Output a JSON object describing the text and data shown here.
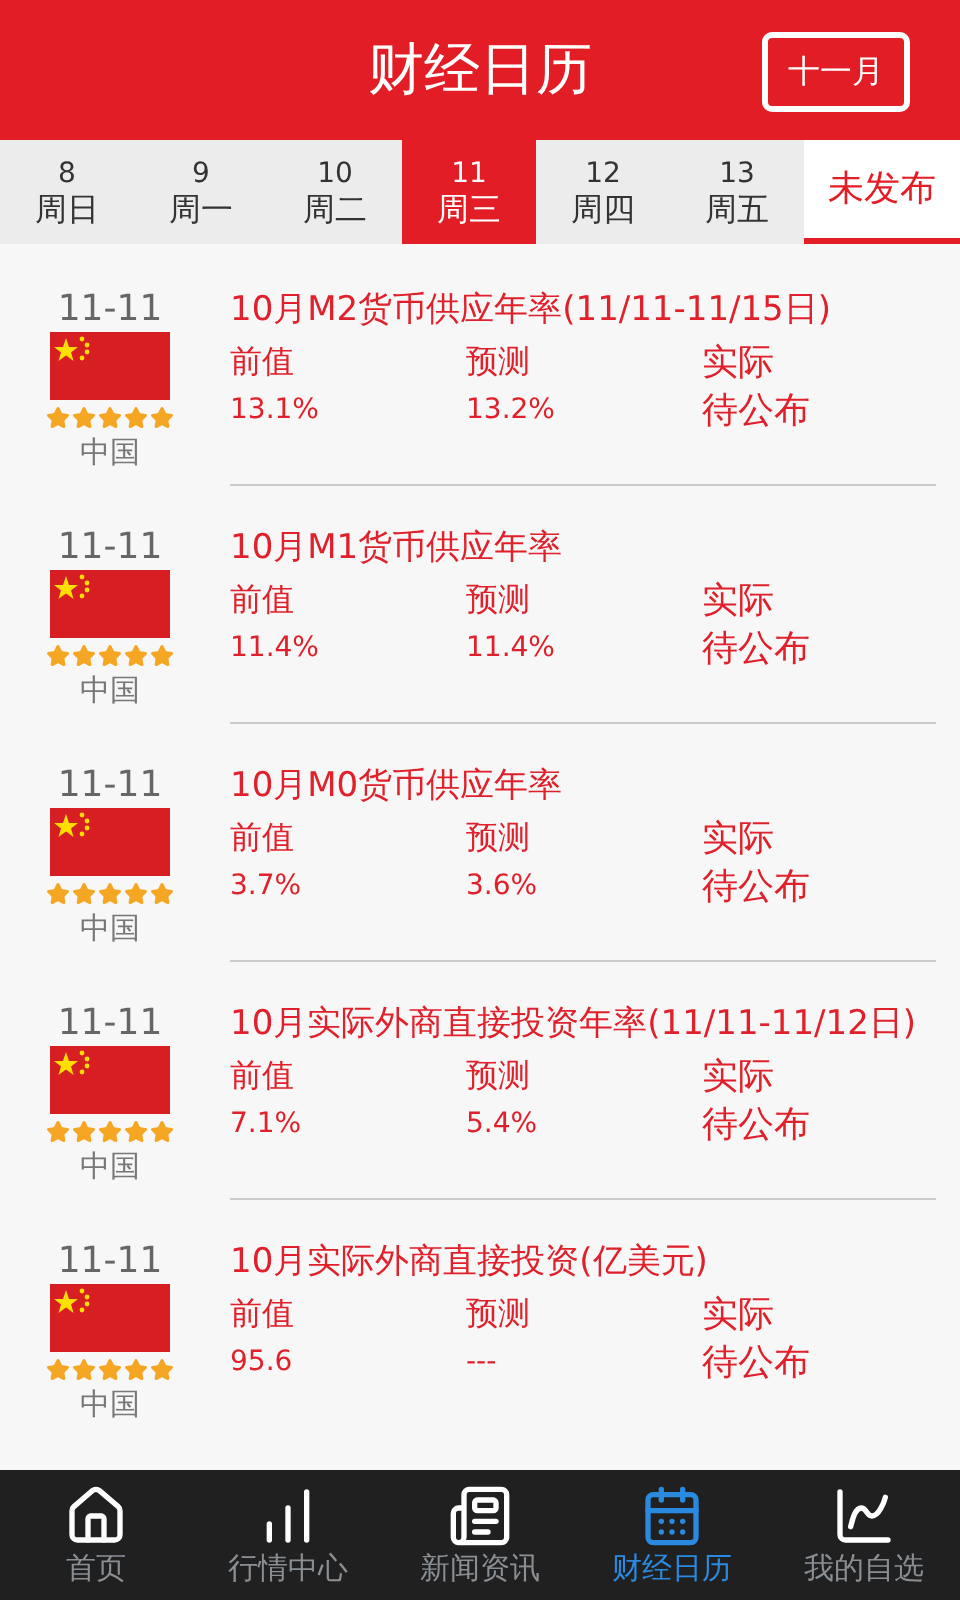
{
  "header": {
    "title": "财经日历",
    "month_button": "十一月"
  },
  "tabs": [
    {
      "day": "8",
      "weekday": "周日",
      "selected": false
    },
    {
      "day": "9",
      "weekday": "周一",
      "selected": false
    },
    {
      "day": "10",
      "weekday": "周二",
      "selected": false
    },
    {
      "day": "11",
      "weekday": "周三",
      "selected": true
    },
    {
      "day": "12",
      "weekday": "周四",
      "selected": false
    },
    {
      "day": "13",
      "weekday": "周五",
      "selected": false
    }
  ],
  "unpublished_tab": {
    "label": "未发布",
    "selected": false
  },
  "events": [
    {
      "date": "11-11",
      "country": "中国",
      "stars": 5,
      "title": "10月M2货币供应年率(11/11-11/15日)",
      "previous_label": "前值",
      "previous": "13.1%",
      "forecast_label": "预测",
      "forecast": "13.2%",
      "actual_label": "实际",
      "actual": "待公布"
    },
    {
      "date": "11-11",
      "country": "中国",
      "stars": 5,
      "title": "10月M1货币供应年率",
      "previous_label": "前值",
      "previous": "11.4%",
      "forecast_label": "预测",
      "forecast": "11.4%",
      "actual_label": "实际",
      "actual": "待公布"
    },
    {
      "date": "11-11",
      "country": "中国",
      "stars": 5,
      "title": "10月M0货币供应年率",
      "previous_label": "前值",
      "previous": "3.7%",
      "forecast_label": "预测",
      "forecast": "3.6%",
      "actual_label": "实际",
      "actual": "待公布"
    },
    {
      "date": "11-11",
      "country": "中国",
      "stars": 5,
      "title": "10月实际外商直接投资年率(11/11-11/12日)",
      "previous_label": "前值",
      "previous": "7.1%",
      "forecast_label": "预测",
      "forecast": "5.4%",
      "actual_label": "实际",
      "actual": "待公布"
    },
    {
      "date": "11-11",
      "country": "中国",
      "stars": 5,
      "title": "10月实际外商直接投资(亿美元)",
      "previous_label": "前值",
      "previous": "95.6",
      "forecast_label": "预测",
      "forecast": "---",
      "actual_label": "实际",
      "actual": "待公布"
    }
  ],
  "bottom_nav": [
    {
      "kind": "home",
      "label": "首页",
      "selected": false
    },
    {
      "kind": "market",
      "label": "行情中心",
      "selected": false
    },
    {
      "kind": "news",
      "label": "新闻资讯",
      "selected": false
    },
    {
      "kind": "calendar",
      "label": "财经日历",
      "selected": true
    },
    {
      "kind": "watchlist",
      "label": "我的自选",
      "selected": false
    }
  ]
}
